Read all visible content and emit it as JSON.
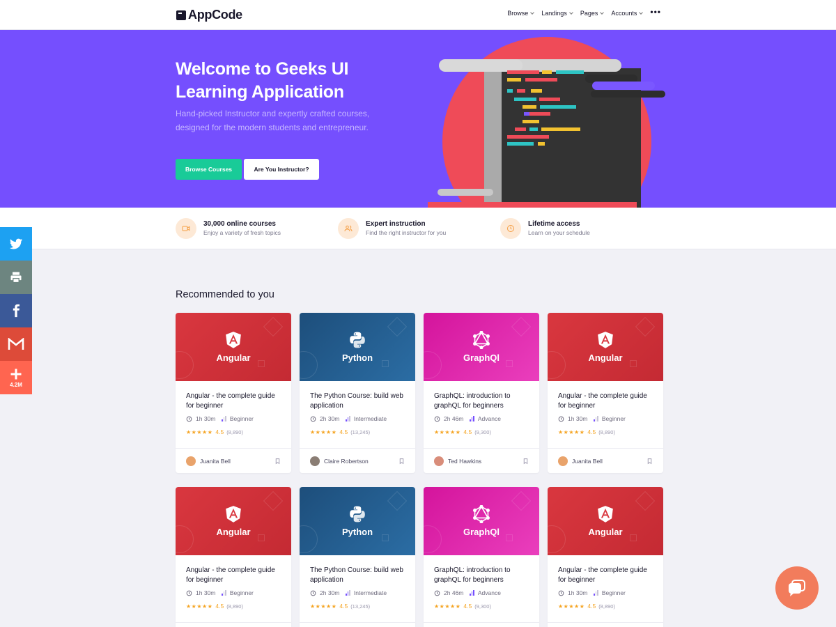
{
  "header": {
    "logo_text": "AppCode",
    "nav": [
      {
        "label": "Browse",
        "has_dropdown": true
      },
      {
        "label": "Landings",
        "has_dropdown": true
      },
      {
        "label": "Pages",
        "has_dropdown": true
      },
      {
        "label": "Accounts",
        "has_dropdown": true
      }
    ],
    "more_icon": "more-dots-icon"
  },
  "hero": {
    "title": "Welcome to Geeks UI Learning Application",
    "subtitle": "Hand-picked Instructor and expertly crafted courses, designed for the modern students and entrepreneur.",
    "primary_button": "Browse Courses",
    "secondary_button": "Are You Instructor?"
  },
  "features": [
    {
      "icon": "video-icon",
      "title": "30,000 online courses",
      "subtitle": "Enjoy a variety of fresh topics"
    },
    {
      "icon": "users-icon",
      "title": "Expert instruction",
      "subtitle": "Find the right instructor for you"
    },
    {
      "icon": "clock-icon",
      "title": "Lifetime access",
      "subtitle": "Learn on your schedule"
    }
  ],
  "section_title": "Recommended to you",
  "courses": [
    {
      "thumb": "Angular",
      "title": "Angular - the complete guide for beginner",
      "duration": "1h 30m",
      "level": "Beginner",
      "level_bars": 1,
      "stars": "★★★★★",
      "rating": "4.5",
      "count": "(8,890)",
      "author": "Juanita Bell"
    },
    {
      "thumb": "Python",
      "title": "The Python Course: build web application",
      "duration": "2h 30m",
      "level": "Intermediate",
      "level_bars": 2,
      "stars": "★★★★★",
      "rating": "4.5",
      "count": "(13,245)",
      "author": "Claire Robertson"
    },
    {
      "thumb": "GraphQl",
      "title": "GraphQL: introduction to graphQL for beginners",
      "duration": "2h 46m",
      "level": "Advance",
      "level_bars": 3,
      "stars": "★★★★★",
      "rating": "4.5",
      "count": "(9,300)",
      "author": "Ted Hawkins"
    },
    {
      "thumb": "Angular",
      "title": "Angular - the complete guide for beginner",
      "duration": "1h 30m",
      "level": "Beginner",
      "level_bars": 1,
      "stars": "★★★★★",
      "rating": "4.5",
      "count": "(8,890)",
      "author": "Juanita Bell"
    },
    {
      "thumb": "Angular",
      "title": "Angular - the complete guide for beginner",
      "duration": "1h 30m",
      "level": "Beginner",
      "level_bars": 1,
      "stars": "★★★★★",
      "rating": "4.5",
      "count": "(8,890)",
      "author": ""
    },
    {
      "thumb": "Python",
      "title": "The Python Course: build web application",
      "duration": "2h 30m",
      "level": "Intermediate",
      "level_bars": 2,
      "stars": "★★★★★",
      "rating": "4.5",
      "count": "(13,245)",
      "author": ""
    },
    {
      "thumb": "GraphQl",
      "title": "GraphQL: introduction to graphQL for beginners",
      "duration": "2h 46m",
      "level": "Advance",
      "level_bars": 3,
      "stars": "★★★★★",
      "rating": "4.5",
      "count": "(9,300)",
      "author": ""
    },
    {
      "thumb": "Angular",
      "title": "Angular - the complete guide for beginner",
      "duration": "1h 30m",
      "level": "Beginner",
      "level_bars": 1,
      "stars": "★★★★★",
      "rating": "4.5",
      "count": "(8,890)",
      "author": ""
    }
  ],
  "share": {
    "count": "4.2M",
    "buttons": [
      "twitter-icon",
      "print-icon",
      "facebook-icon",
      "gmail-icon",
      "plus-icon"
    ]
  },
  "colors": {
    "primary": "#754ffe",
    "success": "#19cb98",
    "angular": "#d9373f",
    "python": "#1d4e7b",
    "graphql": "#d4149c",
    "star": "#f5a524",
    "chat": "#f27c5c"
  }
}
